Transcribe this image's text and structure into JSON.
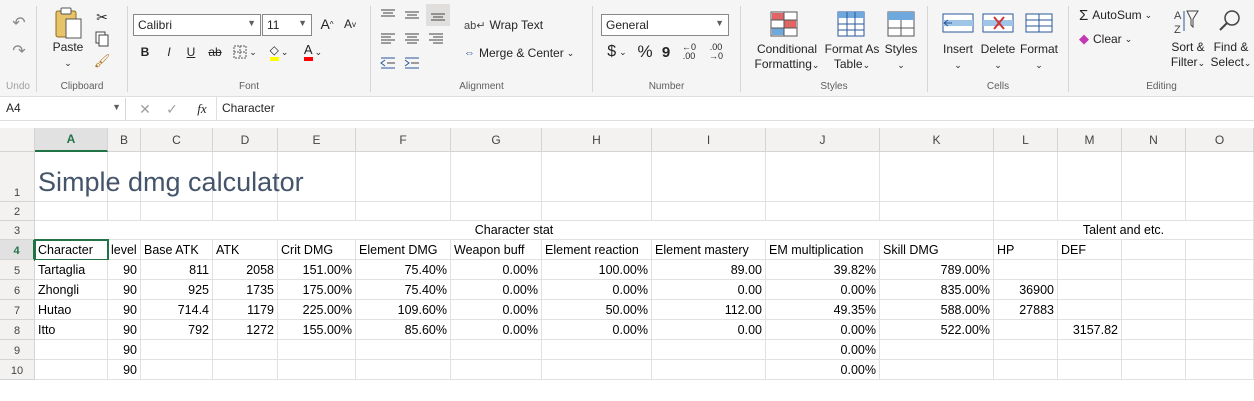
{
  "ribbon": {
    "undo_label": "Undo",
    "clipboard": {
      "paste": "Paste",
      "label": "Clipboard"
    },
    "font": {
      "name": "Calibri",
      "size": "11",
      "label": "Font",
      "bold": "B",
      "italic": "I",
      "underline": "U",
      "strike": "ab",
      "grow": "A",
      "shrink": "A",
      "highlight_color": "#ffff00",
      "font_color": "#ff0000"
    },
    "alignment": {
      "wrap": "Wrap Text",
      "merge": "Merge & Center",
      "label": "Alignment"
    },
    "number": {
      "format": "General",
      "label": "Number",
      "currency": "$",
      "percent": "%",
      "comma": "9"
    },
    "styles": {
      "conditional_1": "Conditional",
      "conditional_2": "Formatting",
      "format_table_1": "Format As",
      "format_table_2": "Table",
      "cell_styles": "Styles",
      "label": "Styles"
    },
    "cells": {
      "insert": "Insert",
      "delete": "Delete",
      "format": "Format",
      "label": "Cells"
    },
    "editing": {
      "autosum": "AutoSum",
      "clear": "Clear",
      "sort_1": "Sort &",
      "sort_2": "Filter",
      "find_1": "Find &",
      "find_2": "Select",
      "label": "Editing"
    }
  },
  "formula_bar": {
    "name_box": "A4",
    "fx": "fx",
    "content": "Character"
  },
  "columns": [
    "A",
    "B",
    "C",
    "D",
    "E",
    "F",
    "G",
    "H",
    "I",
    "J",
    "K",
    "L",
    "M",
    "N",
    "O"
  ],
  "rows": [
    "1",
    "2",
    "3",
    "4",
    "5",
    "6",
    "7",
    "8",
    "9",
    "10"
  ],
  "sheet": {
    "title": "Simple dmg calculator",
    "group_character": "Character stat",
    "group_talent": "Talent and etc.",
    "headers": [
      "Character",
      "level",
      "Base ATK",
      "ATK",
      "Crit DMG",
      "Element DMG",
      "Weapon buff",
      "Element reaction",
      "Element mastery",
      "EM multiplication",
      "Skill DMG",
      "HP",
      "DEF"
    ],
    "data": [
      [
        "Tartaglia",
        "90",
        "811",
        "2058",
        "151.00%",
        "75.40%",
        "0.00%",
        "100.00%",
        "89.00",
        "39.82%",
        "789.00%",
        "",
        ""
      ],
      [
        "Zhongli",
        "90",
        "925",
        "1735",
        "175.00%",
        "75.40%",
        "0.00%",
        "0.00%",
        "0.00",
        "0.00%",
        "835.00%",
        "36900",
        ""
      ],
      [
        "Hutao",
        "90",
        "714.4",
        "1179",
        "225.00%",
        "109.60%",
        "0.00%",
        "50.00%",
        "112.00",
        "49.35%",
        "588.00%",
        "27883",
        ""
      ],
      [
        "Itto",
        "90",
        "792",
        "1272",
        "155.00%",
        "85.60%",
        "0.00%",
        "0.00%",
        "0.00",
        "0.00%",
        "522.00%",
        "",
        "3157.82"
      ],
      [
        "",
        "90",
        "",
        "",
        "",
        "",
        "",
        "",
        "",
        "0.00%",
        "",
        "",
        ""
      ],
      [
        "",
        "90",
        "",
        "",
        "",
        "",
        "",
        "",
        "",
        "0.00%",
        "",
        "",
        ""
      ]
    ]
  }
}
